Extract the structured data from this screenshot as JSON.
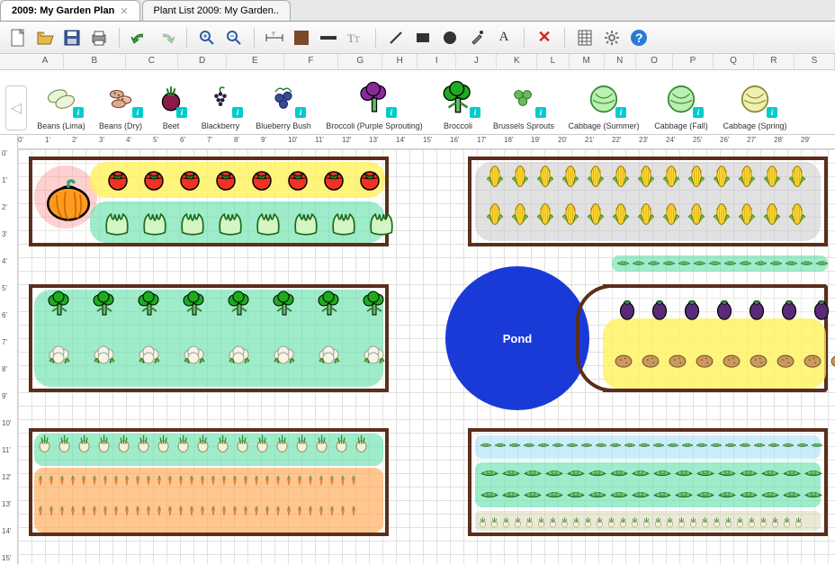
{
  "tabs": [
    {
      "label": "2009: My Garden Plan",
      "active": true,
      "closable": true
    },
    {
      "label": "Plant List 2009: My Garden..",
      "active": false,
      "closable": false
    }
  ],
  "toolbar": {
    "new": "New",
    "open": "Open",
    "save": "Save",
    "print": "Print",
    "undo": "Undo",
    "redo": "Redo",
    "zoom_in": "Zoom In",
    "zoom_out": "Zoom Out",
    "dims": "Dimensions",
    "fill": "Fill Color",
    "line": "Line",
    "text_tool": "A",
    "brush": "Brush",
    "rect": "Rectangle",
    "ellipse": "Ellipse",
    "paint": "Paint",
    "textA": "Text",
    "delete": "Delete",
    "table": "Table",
    "settings": "Settings",
    "help": "Help"
  },
  "columns": [
    "A",
    "B",
    "C",
    "D",
    "E",
    "F",
    "G",
    "H",
    "I",
    "J",
    "K",
    "L",
    "M",
    "N",
    "O",
    "P",
    "Q",
    "R",
    "S"
  ],
  "palette_items": [
    {
      "id": "beans-lima",
      "label": "Beans (Lima)"
    },
    {
      "id": "beans-dry",
      "label": "Beans (Dry)"
    },
    {
      "id": "beet",
      "label": "Beet"
    },
    {
      "id": "blackberry",
      "label": "Blackberry"
    },
    {
      "id": "blueberry",
      "label": "Blueberry Bush"
    },
    {
      "id": "broccoli-purple",
      "label": "Broccoli (Purple Sprouting)"
    },
    {
      "id": "broccoli",
      "label": "Broccoli"
    },
    {
      "id": "brussels",
      "label": "Brussels Sprouts"
    },
    {
      "id": "cabbage-summer",
      "label": "Cabbage (Summer)"
    },
    {
      "id": "cabbage-fall",
      "label": "Cabbage (Fall)"
    },
    {
      "id": "cabbage-spring",
      "label": "Cabbage (Spring)"
    }
  ],
  "info_badge": "i",
  "ruler_h": [
    "0'",
    "1'",
    "2'",
    "3'",
    "4'",
    "5'",
    "6'",
    "7'",
    "8'",
    "9'",
    "10'",
    "11'",
    "12'",
    "13'",
    "14'",
    "15'",
    "16'",
    "17'",
    "18'",
    "19'",
    "20'",
    "21'",
    "22'",
    "23'",
    "24'",
    "25'",
    "26'",
    "27'",
    "28'",
    "29'"
  ],
  "ruler_v": [
    "0'",
    "1'",
    "2'",
    "3'",
    "4'",
    "5'",
    "6'",
    "7'",
    "8'",
    "9'",
    "10'",
    "11'",
    "12'",
    "13'",
    "14'",
    "15'"
  ],
  "pond_label": "Pond",
  "colors": {
    "bed_border": "#5a2e1a",
    "pond": "#1a3ad8"
  }
}
